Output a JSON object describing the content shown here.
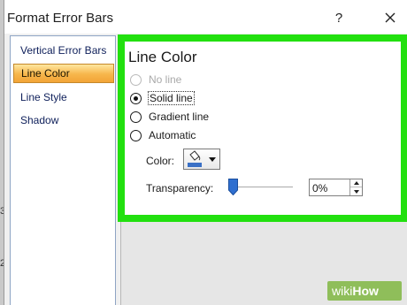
{
  "window": {
    "title": "Format Error Bars",
    "help_glyph": "?"
  },
  "sidebar": {
    "items": [
      {
        "label": "Vertical Error Bars",
        "active": false
      },
      {
        "label": "Line Color",
        "active": true
      },
      {
        "label": "Line Style",
        "active": false
      },
      {
        "label": "Shadow",
        "active": false
      }
    ]
  },
  "background_marks": [
    "3",
    "2"
  ],
  "panel": {
    "heading": "Line Color",
    "options": [
      {
        "label": "No line",
        "checked": false,
        "disabled": true
      },
      {
        "label": "Solid line",
        "checked": true,
        "disabled": false
      },
      {
        "label": "Gradient line",
        "checked": false,
        "disabled": false
      },
      {
        "label": "Automatic",
        "checked": false,
        "disabled": false
      }
    ],
    "color_label": "Color:",
    "color_icon": "paint-bucket-icon",
    "selected_color": "#3a70c6",
    "transparency_label": "Transparency:",
    "transparency_value": "0%",
    "transparency_level": 0
  },
  "highlight_color": "#22e00f",
  "watermark": {
    "part1": "wiki",
    "part2": "How"
  }
}
